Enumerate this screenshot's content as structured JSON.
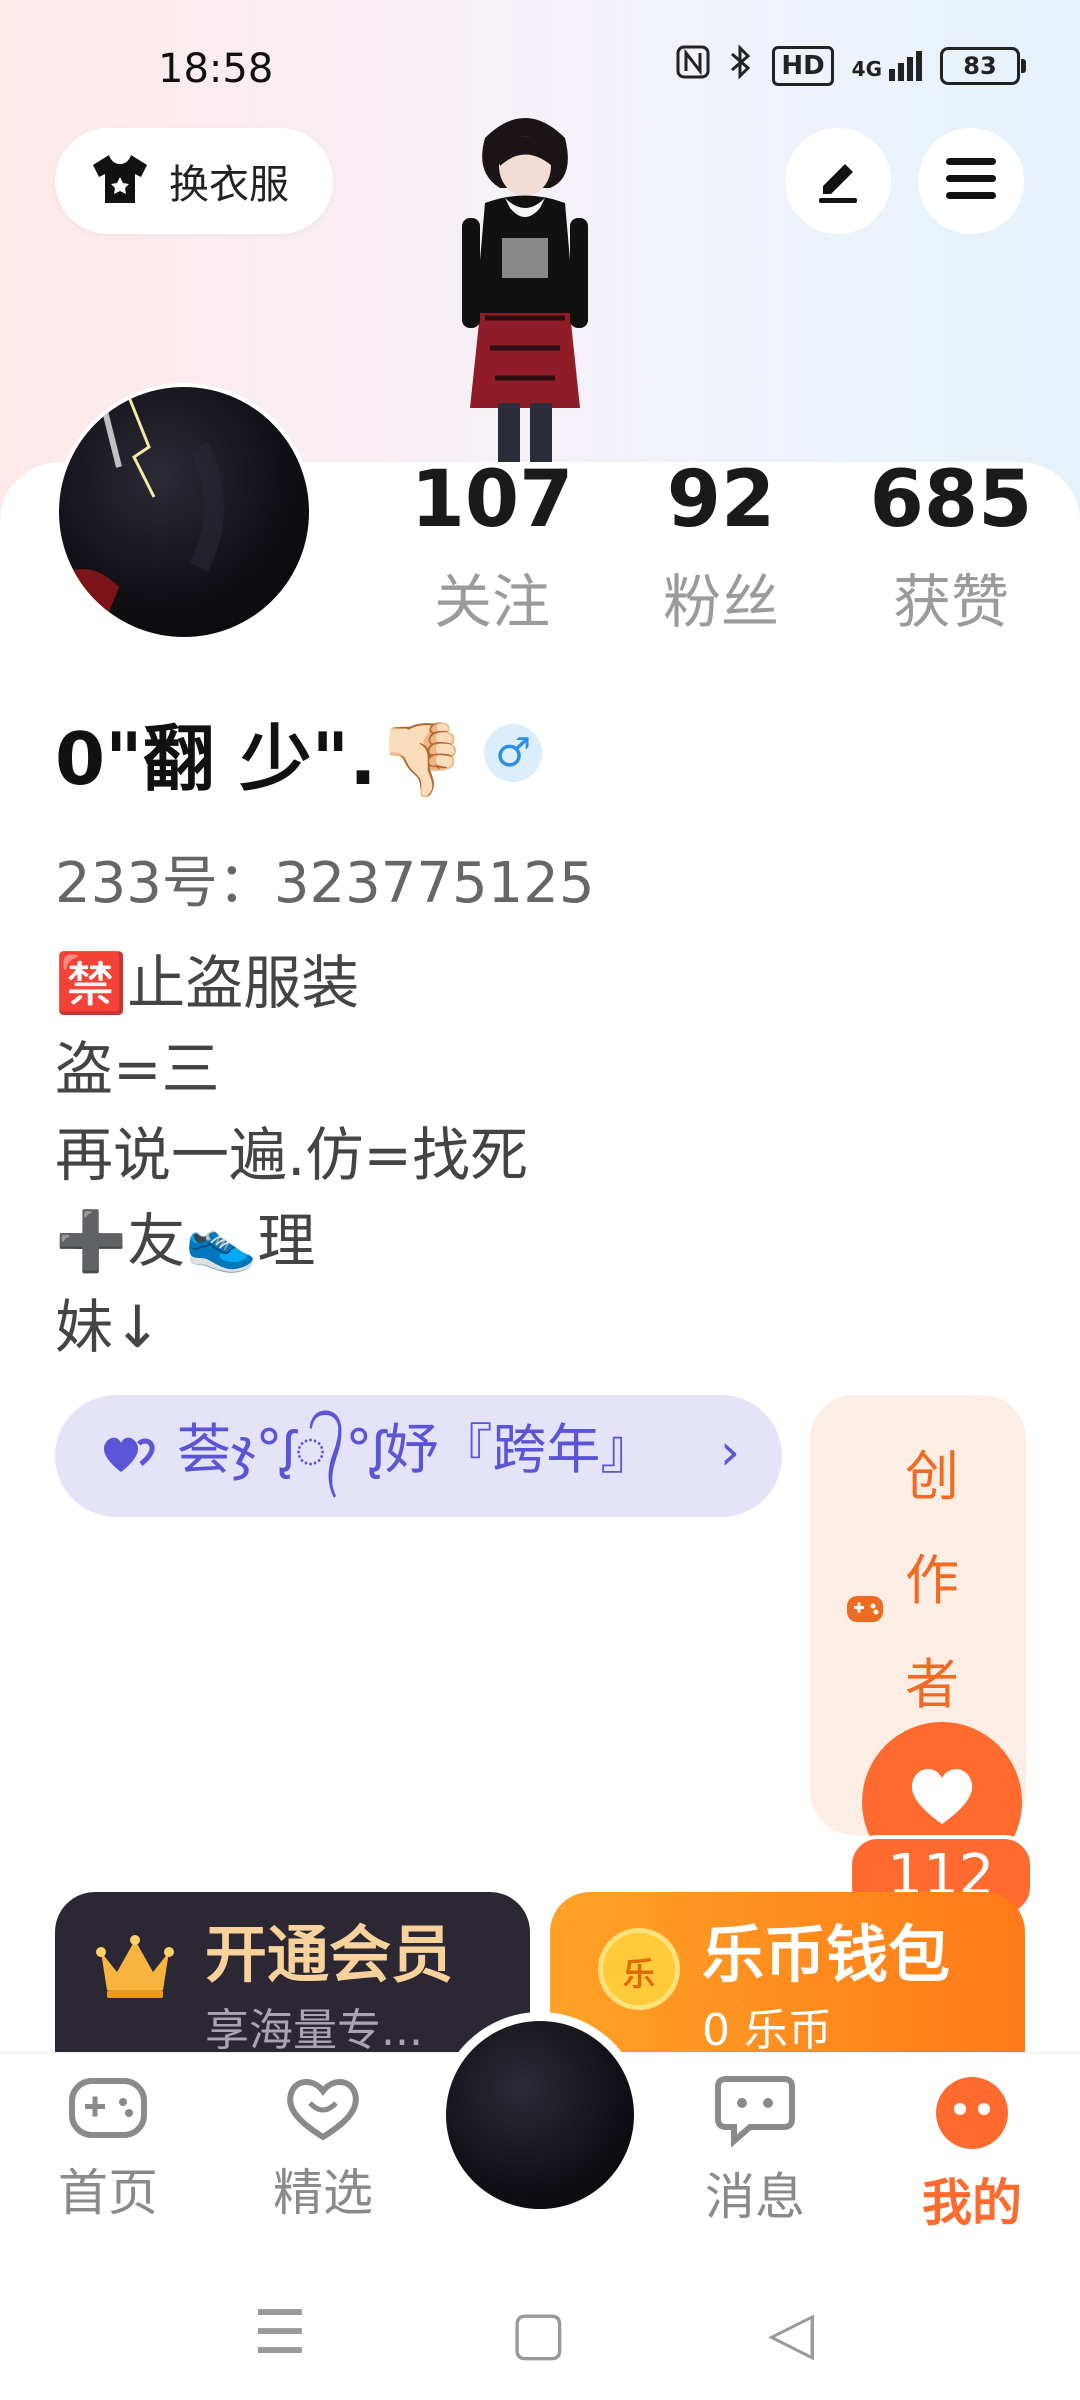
{
  "status": {
    "time": "18:58",
    "icons": [
      "nfc-icon",
      "bluetooth-icon",
      "hd-icon",
      "4g-signal-icon"
    ],
    "hd": "HD",
    "network": "4G",
    "battery": "83"
  },
  "header": {
    "outfit_label": "换衣服",
    "edit_icon": "pencil-icon",
    "menu_icon": "hamburger-menu-icon"
  },
  "stats": [
    {
      "num": "107",
      "label": "关注"
    },
    {
      "num": "92",
      "label": "粉丝"
    },
    {
      "num": "685",
      "label": "获赞"
    }
  ],
  "profile": {
    "name": "0\"翻 少\".👎🏻",
    "gender": "♂",
    "uid": "233号：323775125",
    "bio": [
      "🈲止盗服装",
      "盗=三",
      "再说一遍.仿=找死",
      "➕友👟理",
      "妹↓"
    ]
  },
  "fan_group": {
    "text": "荟ჯ°ᶘ᭄°ᶘ妤『跨年』",
    "icon": "heart-pair-icon"
  },
  "creator": {
    "text": "创作者中",
    "icon": "gamepad-icon"
  },
  "likes": {
    "count": "112"
  },
  "vip": {
    "title": "开通会员",
    "sub": "享海量专..."
  },
  "wallet": {
    "title": "乐币钱包",
    "sub": "0 乐币",
    "coin": "乐"
  },
  "tabs": [
    {
      "label": "首页",
      "icon": "gamepad-icon"
    },
    {
      "label": "精选",
      "icon": "heart-icon"
    },
    {
      "label": "消息",
      "icon": "chat-bubble-icon"
    },
    {
      "label": "我的",
      "icon": "profile-dots-icon"
    }
  ],
  "nav": [
    "☰",
    "▢",
    "◁"
  ],
  "colors": {
    "accent": "#ff6a2e",
    "purple": "#5a55d6",
    "vip_gold": "#f8d29a"
  }
}
